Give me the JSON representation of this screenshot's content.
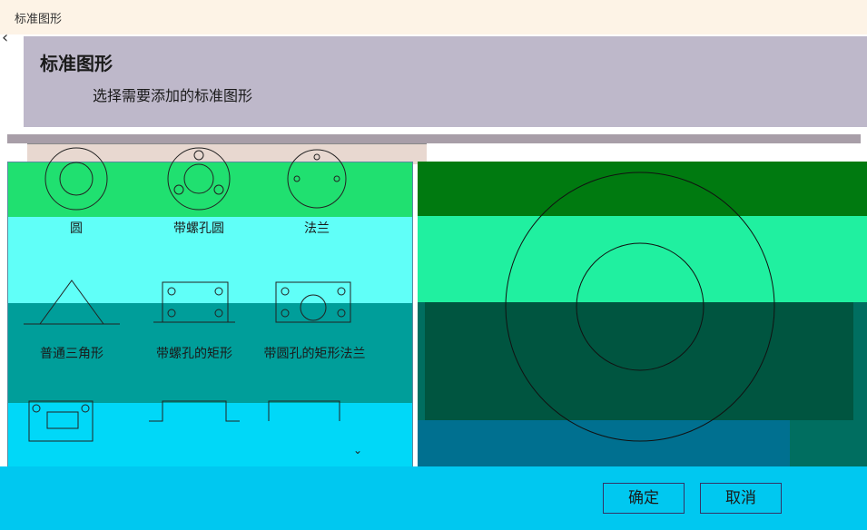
{
  "window": {
    "title": "标准图形"
  },
  "header": {
    "title": "标准图形",
    "subtitle": "选择需要添加的标准图形"
  },
  "shapes": [
    {
      "label": "圆"
    },
    {
      "label": "带螺孔圆"
    },
    {
      "label": "法兰"
    },
    {
      "label": "普通三角形"
    },
    {
      "label": "带螺孔的矩形"
    },
    {
      "label": "带圆孔的矩形法兰"
    },
    {
      "label": ""
    },
    {
      "label": ""
    },
    {
      "label": ""
    }
  ],
  "buttons": {
    "ok": "确定",
    "cancel": "取消"
  },
  "icons": {
    "back": "back-chevron-icon",
    "scroll": "chevron-down-icon"
  }
}
